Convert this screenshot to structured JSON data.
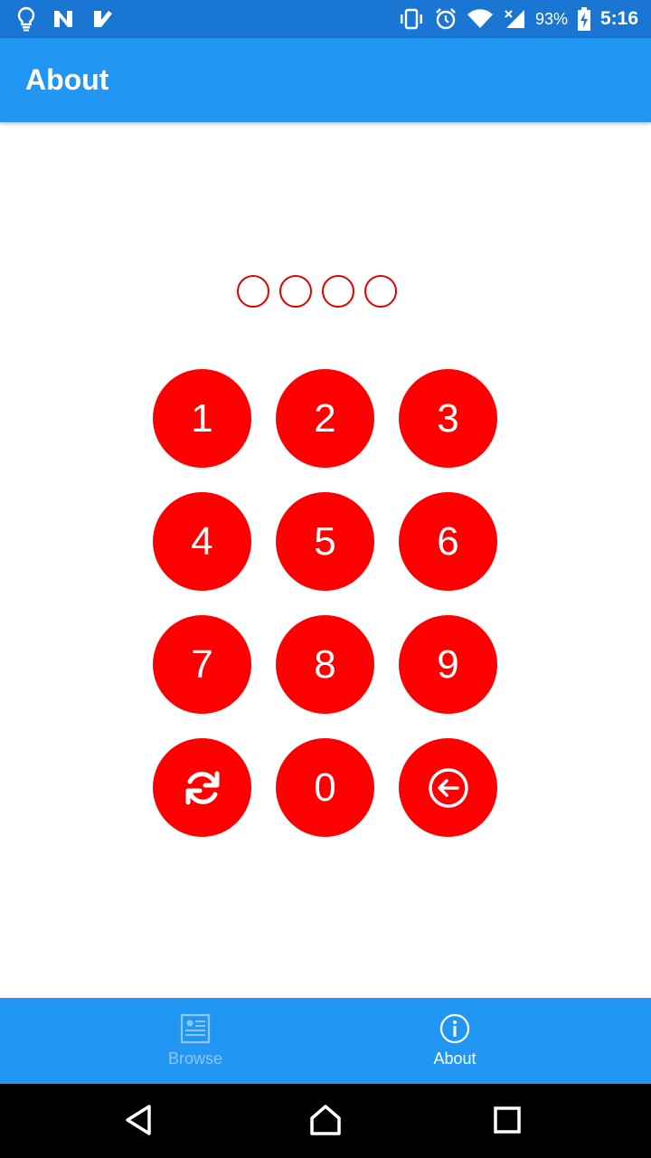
{
  "status_bar": {
    "battery_percent": "93%",
    "time": "5:16",
    "left_icons": [
      "lightbulb-icon",
      "n-app-icon",
      "check-app-icon"
    ],
    "right_icons": [
      "vibrate-icon",
      "alarm-icon",
      "wifi-icon",
      "signal-icon",
      "battery-charging-icon"
    ],
    "background": "#1976D2"
  },
  "app_bar": {
    "title": "About",
    "background": "#2196F3"
  },
  "pin": {
    "length": 4,
    "entered": 0,
    "color": "#E00000"
  },
  "keypad": {
    "key_color": "#FF0000",
    "keys": [
      "1",
      "2",
      "3",
      "4",
      "5",
      "6",
      "7",
      "8",
      "9",
      "0"
    ],
    "refresh_icon": "refresh-icon",
    "backspace_icon": "backspace-icon"
  },
  "tabs": [
    {
      "label": "Browse",
      "icon": "list-icon",
      "active": false
    },
    {
      "label": "About",
      "icon": "info-icon",
      "active": true
    }
  ],
  "nav_bar": {
    "buttons": [
      "back-icon",
      "home-icon",
      "recents-icon"
    ]
  }
}
